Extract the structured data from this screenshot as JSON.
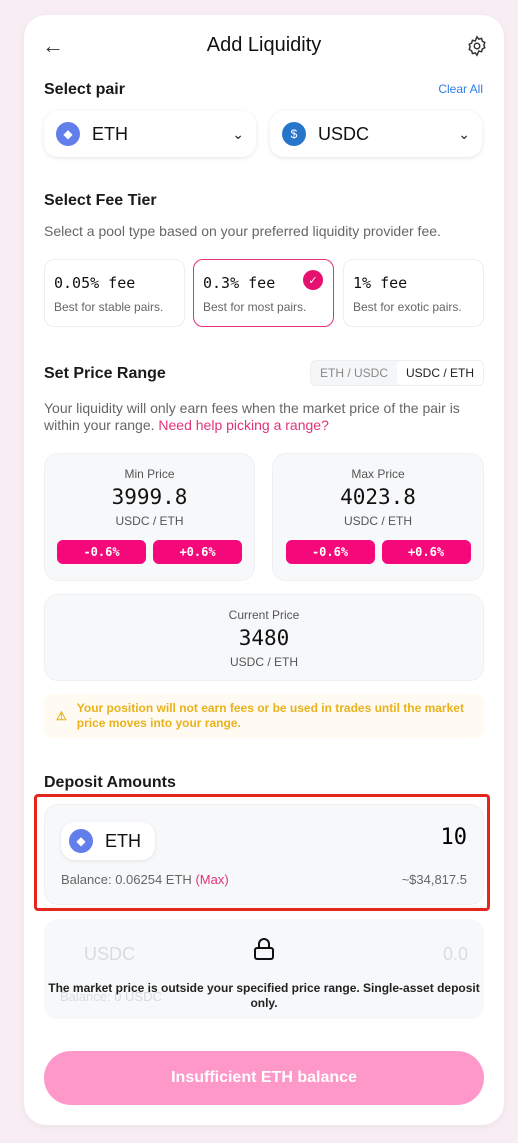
{
  "header": {
    "title": "Add Liquidity",
    "back_icon": "arrow-left-icon",
    "settings_icon": "gear-icon"
  },
  "pair": {
    "label": "Select pair",
    "clear_label": "Clear All",
    "token_a": "ETH",
    "token_b": "USDC"
  },
  "fee": {
    "label": "Select Fee Tier",
    "description": "Select a pool type based on your preferred liquidity provider fee.",
    "tiers": [
      {
        "title": "0.05% fee",
        "desc": "Best for stable pairs.",
        "selected": false
      },
      {
        "title": "0.3% fee",
        "desc": "Best for most pairs.",
        "selected": true
      },
      {
        "title": "1% fee",
        "desc": "Best for exotic pairs.",
        "selected": false
      }
    ]
  },
  "range": {
    "label": "Set Price Range",
    "toggle": [
      "ETH / USDC",
      "USDC / ETH"
    ],
    "toggle_selected": "USDC / ETH",
    "description": "Your liquidity will only earn fees when the market price of the pair is within your range.",
    "help_link": "Need help picking a range?",
    "min": {
      "label": "Min Price",
      "value": "3999.8",
      "unit": "USDC / ETH",
      "dec": "-0.6%",
      "inc": "+0.6%"
    },
    "max": {
      "label": "Max Price",
      "value": "4023.8",
      "unit": "USDC / ETH",
      "dec": "-0.6%",
      "inc": "+0.6%"
    },
    "current": {
      "label": "Current Price",
      "value": "3480",
      "unit": "USDC / ETH"
    },
    "warning": "Your position will not earn fees or be used in trades until the market price moves into your range."
  },
  "deposit": {
    "label": "Deposit Amounts",
    "token_a": {
      "symbol": "ETH",
      "amount": "10",
      "balance": "Balance: 0.06254 ETH",
      "max": "(Max)",
      "usd": "~$34,817.5"
    },
    "token_b": {
      "symbol": "USDC",
      "amount": "0.0",
      "balance": "Balance: 0 USDC",
      "lock_message": "The market price is outside your specified price range. Single-asset deposit only."
    }
  },
  "submit_label": "Insufficient ETH balance",
  "colors": {
    "accent": "#f5087a",
    "link": "#2f7de1",
    "warning": "#e9b21c",
    "submit": "#fd98c8"
  }
}
